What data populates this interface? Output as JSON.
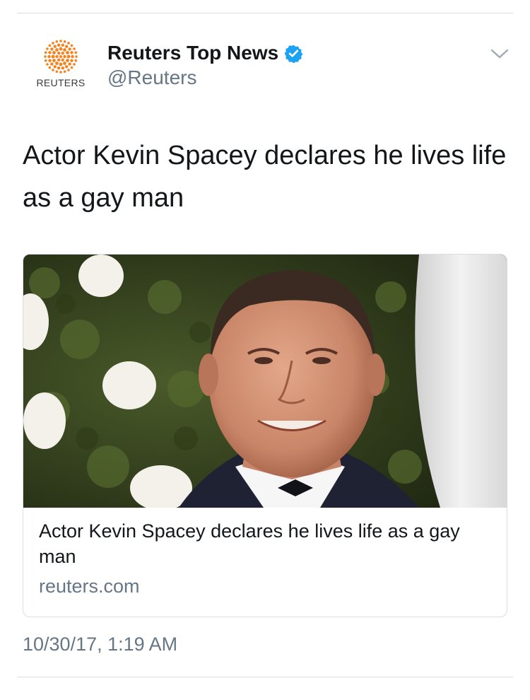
{
  "account": {
    "display_name": "Reuters Top News",
    "handle": "@Reuters",
    "avatar_wordmark": "REUTERS",
    "verified": true
  },
  "tweet": {
    "text": "Actor Kevin Spacey declares he lives life as a gay man",
    "timestamp": "10/30/17, 1:19 AM"
  },
  "card": {
    "title": "Actor Kevin Spacey declares he lives life as a gay man",
    "domain": "reuters.com"
  },
  "icons": {
    "verified": "verified-badge-icon",
    "menu": "chevron-down-icon",
    "logo": "reuters-dot-logo"
  },
  "colors": {
    "verified_blue": "#1da1f2",
    "reuters_orange": "#f5821f",
    "secondary_text": "#657786",
    "border": "#d9dee2"
  }
}
